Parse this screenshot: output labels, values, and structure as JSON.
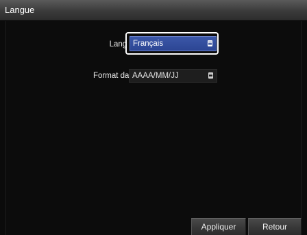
{
  "window": {
    "title": "Langue"
  },
  "form": {
    "langue": {
      "label": "Langue",
      "value": "Français",
      "icon": "list-icon"
    },
    "date_format": {
      "label": "Format date",
      "value": "AAAA/MM/JJ",
      "icon": "list-icon"
    }
  },
  "footer": {
    "apply_label": "Appliquer",
    "back_label": "Retour"
  },
  "colors": {
    "focused_select": "#2c4593",
    "titlebar": "#3b3b3b",
    "background": "#0c0c0c"
  }
}
